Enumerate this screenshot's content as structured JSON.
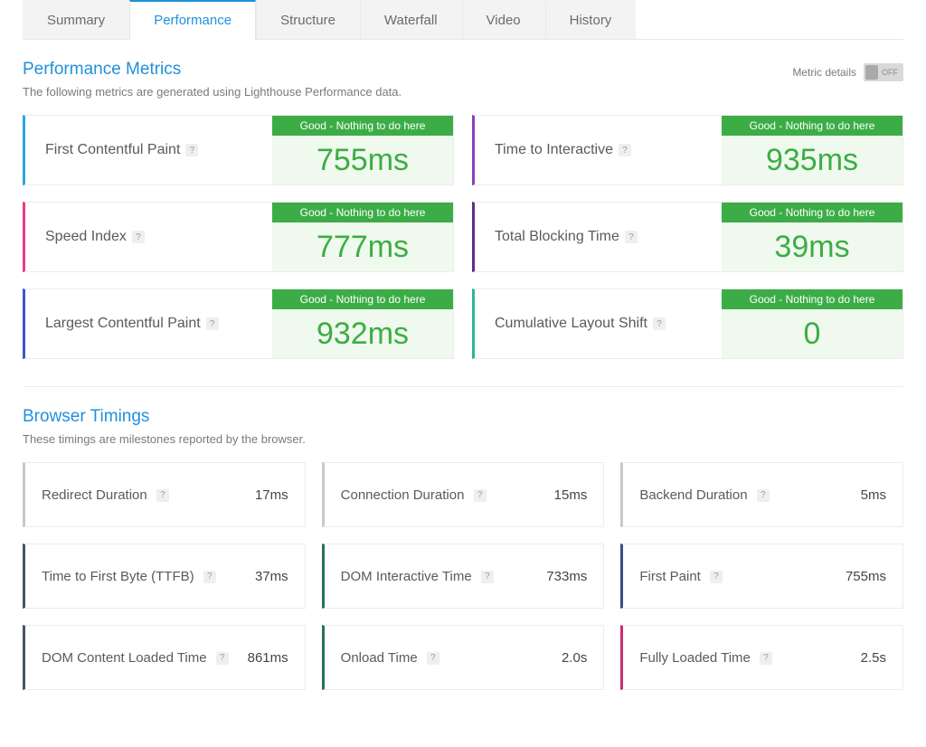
{
  "tabs": {
    "summary": "Summary",
    "performance": "Performance",
    "structure": "Structure",
    "waterfall": "Waterfall",
    "video": "Video",
    "history": "History"
  },
  "perf_section": {
    "title": "Performance Metrics",
    "sub": "The following metrics are generated using Lighthouse Performance data.",
    "toggle_label": "Metric details",
    "toggle_state": "OFF",
    "status_good": "Good - Nothing to do here",
    "metrics": {
      "fcp": {
        "label": "First Contentful Paint",
        "value": "755ms"
      },
      "tti": {
        "label": "Time to Interactive",
        "value": "935ms"
      },
      "si": {
        "label": "Speed Index",
        "value": "777ms"
      },
      "tbt": {
        "label": "Total Blocking Time",
        "value": "39ms"
      },
      "lcp": {
        "label": "Largest Contentful Paint",
        "value": "932ms"
      },
      "cls": {
        "label": "Cumulative Layout Shift",
        "value": "0"
      }
    }
  },
  "timings_section": {
    "title": "Browser Timings",
    "sub": "These timings are milestones reported by the browser.",
    "items": {
      "redirect": {
        "label": "Redirect Duration",
        "value": "17ms"
      },
      "connection": {
        "label": "Connection Duration",
        "value": "15ms"
      },
      "backend": {
        "label": "Backend Duration",
        "value": "5ms"
      },
      "ttfb": {
        "label": "Time to First Byte (TTFB)",
        "value": "37ms"
      },
      "domint": {
        "label": "DOM Interactive Time",
        "value": "733ms"
      },
      "fpaint": {
        "label": "First Paint",
        "value": "755ms"
      },
      "domcl": {
        "label": "DOM Content Loaded Time",
        "value": "861ms"
      },
      "onload": {
        "label": "Onload Time",
        "value": "2.0s"
      },
      "fully": {
        "label": "Fully Loaded Time",
        "value": "2.5s"
      }
    }
  },
  "help_glyph": "?"
}
